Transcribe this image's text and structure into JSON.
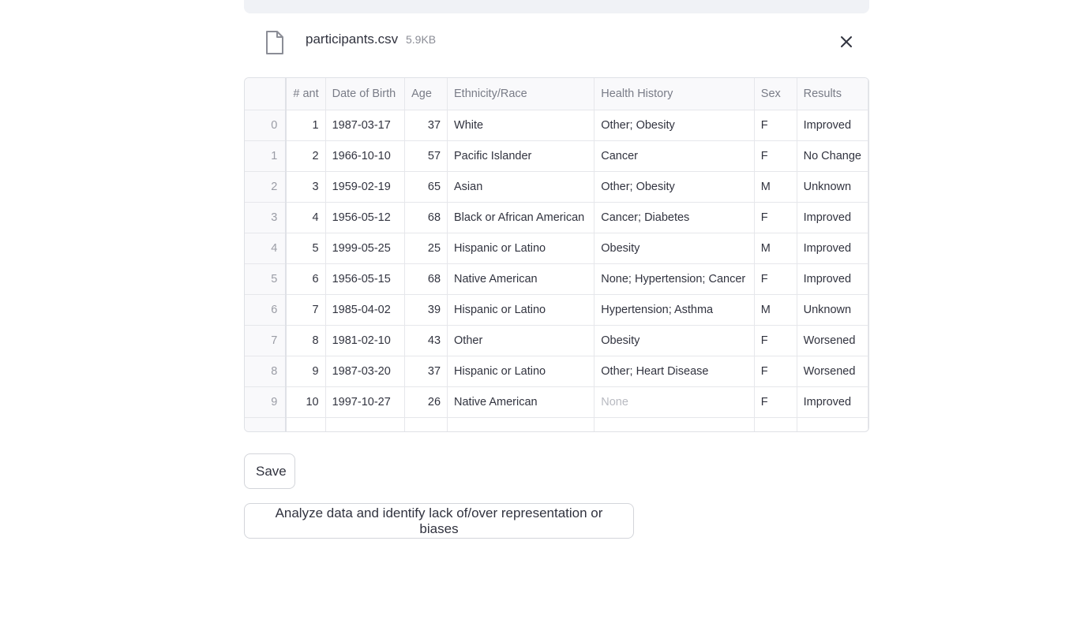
{
  "file": {
    "name": "participants.csv",
    "size": "5.9KB"
  },
  "table": {
    "headers": [
      "",
      "ant #",
      "Date of Birth",
      "Age",
      "Ethnicity/Race",
      "Health History",
      "Sex",
      "Results"
    ],
    "rows": [
      [
        "0",
        "1",
        "1987-03-17",
        "37",
        "White",
        "Other; Obesity",
        "F",
        "Improved"
      ],
      [
        "1",
        "2",
        "1966-10-10",
        "57",
        "Pacific Islander",
        "Cancer",
        "F",
        "No Change"
      ],
      [
        "2",
        "3",
        "1959-02-19",
        "65",
        "Asian",
        "Other; Obesity",
        "M",
        "Unknown"
      ],
      [
        "3",
        "4",
        "1956-05-12",
        "68",
        "Black or African American",
        "Cancer; Diabetes",
        "F",
        "Improved"
      ],
      [
        "4",
        "5",
        "1999-05-25",
        "25",
        "Hispanic or Latino",
        "Obesity",
        "M",
        "Improved"
      ],
      [
        "5",
        "6",
        "1956-05-15",
        "68",
        "Native American",
        "None; Hypertension; Cancer",
        "F",
        "Improved"
      ],
      [
        "6",
        "7",
        "1985-04-02",
        "39",
        "Hispanic or Latino",
        "Hypertension; Asthma",
        "M",
        "Unknown"
      ],
      [
        "7",
        "8",
        "1981-02-10",
        "43",
        "Other",
        "Obesity",
        "F",
        "Worsened"
      ],
      [
        "8",
        "9",
        "1987-03-20",
        "37",
        "Hispanic or Latino",
        "Other; Heart Disease",
        "F",
        "Worsened"
      ],
      [
        "9",
        "10",
        "1997-10-27",
        "26",
        "Native American",
        "None",
        "F",
        "Improved"
      ]
    ]
  },
  "buttons": {
    "save": "Save",
    "analyze": "Analyze data and identify lack of/over representation or biases"
  },
  "icons": {
    "file": "file-icon",
    "close": "close-icon"
  }
}
